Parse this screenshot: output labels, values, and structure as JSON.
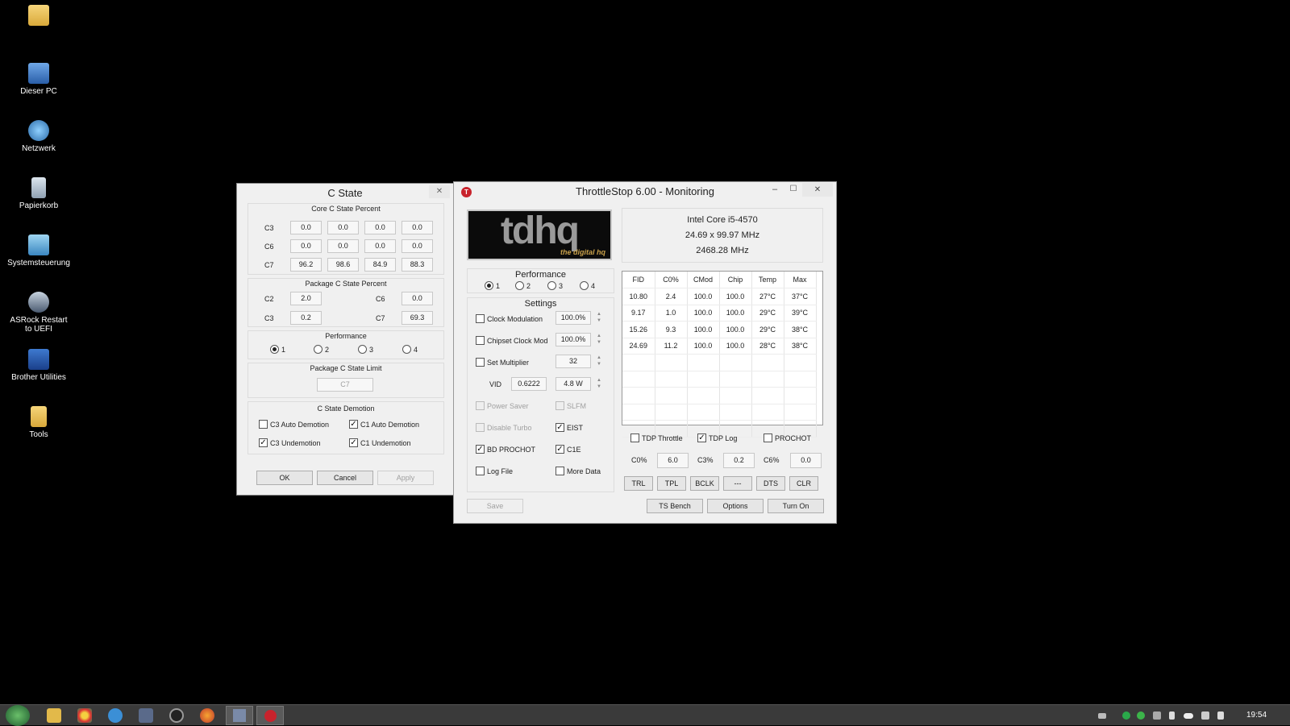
{
  "desktop": {
    "icons": [
      {
        "label": "",
        "icon": "folder-icon"
      },
      {
        "label": "Dieser PC",
        "icon": "computer-icon"
      },
      {
        "label": "Netzwerk",
        "icon": "network-icon"
      },
      {
        "label": "Papierkorb",
        "icon": "recycle-bin-icon"
      },
      {
        "label": "Systemsteuerung",
        "icon": "control-panel-icon"
      },
      {
        "label": "ASRock Restart to UEFI",
        "icon": "uefi-icon"
      },
      {
        "label": "Brother Utilities",
        "icon": "brother-icon"
      },
      {
        "label": "Tools",
        "icon": "folder-icon"
      }
    ]
  },
  "cstate": {
    "title": "C State",
    "close": "✕",
    "core_title": "Core C State Percent",
    "core_rows": [
      {
        "label": "C3",
        "values": [
          "0.0",
          "0.0",
          "0.0",
          "0.0"
        ]
      },
      {
        "label": "C6",
        "values": [
          "0.0",
          "0.0",
          "0.0",
          "0.0"
        ]
      },
      {
        "label": "C7",
        "values": [
          "96.2",
          "98.6",
          "84.9",
          "88.3"
        ]
      }
    ],
    "package_title": "Package C State Percent",
    "package": {
      "c2_label": "C2",
      "c2": "2.0",
      "c6_label": "C6",
      "c6": "0.0",
      "c3_label": "C3",
      "c3": "0.2",
      "c7_label": "C7",
      "c7": "69.3"
    },
    "performance_title": "Performance",
    "performance_options": [
      "1",
      "2",
      "3",
      "4"
    ],
    "performance_selected": "1",
    "limit_title": "Package C State Limit",
    "limit_value": "C7",
    "demotion_title": "C State Demotion",
    "demotion": {
      "c3_auto": {
        "label": "C3 Auto Demotion",
        "checked": false
      },
      "c1_auto": {
        "label": "C1 Auto Demotion",
        "checked": true
      },
      "c3_un": {
        "label": "C3 Undemotion",
        "checked": true
      },
      "c1_un": {
        "label": "C1 Undemotion",
        "checked": true
      }
    },
    "buttons": {
      "ok": "OK",
      "cancel": "Cancel",
      "apply": "Apply"
    }
  },
  "ts": {
    "title": "ThrottleStop 6.00 - Monitoring",
    "app_icon": "T",
    "controls": {
      "minimize": "–",
      "maximize": "☐",
      "close": "✕"
    },
    "logo_main": "tdhq",
    "logo_sub": "the digital hq",
    "cpu": {
      "name": "Intel Core i5-4570",
      "mult": "24.69 x 99.97 MHz",
      "freq": "2468.28 MHz"
    },
    "performance_title": "Performance",
    "performance_options": [
      "1",
      "2",
      "3",
      "4"
    ],
    "performance_selected": "1",
    "settings_title": "Settings",
    "settings": {
      "clock_mod": {
        "label": "Clock Modulation",
        "value": "100.0%",
        "checked": false
      },
      "chipset_mod": {
        "label": "Chipset Clock Mod",
        "value": "100.0%",
        "checked": false
      },
      "set_mult": {
        "label": "Set Multiplier",
        "value": "32",
        "checked": false
      },
      "vid_label": "VID",
      "vid": "0.6222",
      "watts": "4.8 W",
      "power_saver": {
        "label": "Power Saver",
        "checked": false
      },
      "slfm": {
        "label": "SLFM",
        "checked": false
      },
      "disable_turbo": {
        "label": "Disable Turbo",
        "checked": false
      },
      "eist": {
        "label": "EIST",
        "checked": true
      },
      "bd_prochot": {
        "label": "BD PROCHOT",
        "checked": true
      },
      "c1e": {
        "label": "C1E",
        "checked": true
      },
      "log_file": {
        "label": "Log File",
        "checked": false
      },
      "more_data": {
        "label": "More Data",
        "checked": false
      }
    },
    "table": {
      "headers": [
        "FID",
        "C0%",
        "CMod",
        "Chip",
        "Temp",
        "Max"
      ],
      "rows": [
        [
          "10.80",
          "2.4",
          "100.0",
          "100.0",
          "27°C",
          "37°C"
        ],
        [
          "9.17",
          "1.0",
          "100.0",
          "100.0",
          "29°C",
          "39°C"
        ],
        [
          "15.26",
          "9.3",
          "100.0",
          "100.0",
          "29°C",
          "38°C"
        ],
        [
          "24.69",
          "11.2",
          "100.0",
          "100.0",
          "28°C",
          "38°C"
        ]
      ]
    },
    "tdp_throttle": {
      "label": "TDP Throttle",
      "checked": false
    },
    "tdp_log": {
      "label": "TDP Log",
      "checked": true
    },
    "prochot": {
      "label": "PROCHOT",
      "checked": false
    },
    "c0_label": "C0%",
    "c0": "6.0",
    "c3_label": "C3%",
    "c3": "0.2",
    "c6_label": "C6%",
    "c6": "0.0",
    "small_buttons": [
      "TRL",
      "TPL",
      "BCLK",
      "---",
      "DTS",
      "CLR"
    ],
    "save": "Save",
    "ts_bench": "TS Bench",
    "options": "Options",
    "turn_on": "Turn On"
  },
  "taskbar": {
    "clock": "19:54",
    "apps": [
      "start-orb-icon",
      "file-explorer-icon",
      "chrome-icon",
      "internet-explorer-icon",
      "floppy-app-icon",
      "gpu-app-icon",
      "firefox-icon",
      "network-app-icon",
      "throttlestop-icon"
    ],
    "tray": [
      "keyboard-icon",
      "throttlestop-tray-icon",
      "green-tray-icon",
      "drive-tray-icon",
      "flag-icon",
      "cloud-icon",
      "network-tray-icon",
      "volume-icon"
    ]
  },
  "colors": {
    "desktop": "#000000",
    "window": "#f0f0f0",
    "taskbar": "#3a3a3a",
    "accent_red": "#c8232c"
  }
}
